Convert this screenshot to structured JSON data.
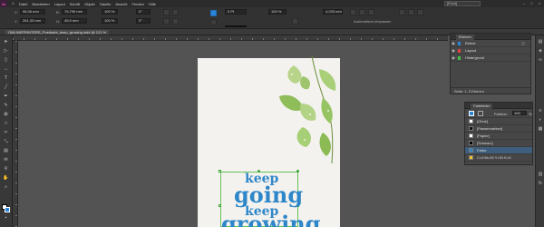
{
  "menubar": {
    "logo": "Id",
    "items": [
      "Datei",
      "Bearbeiten",
      "Layout",
      "Schrift",
      "Objekt",
      "Tabelle",
      "Ansicht",
      "Fenster",
      "Hilfe"
    ],
    "workspace": "[Einst]"
  },
  "control": {
    "x": "98,36 mm",
    "y": "261,33 mm",
    "w": "75,799 mm",
    "h": "45,9 mm",
    "scale_x": "100 %",
    "scale_y": "100 %",
    "angle": "0°",
    "shear": "0°",
    "stroke": "0 Pt",
    "zoom": "100 %",
    "autofit": "Automatisch einpassen",
    "corner": "4,233 mm"
  },
  "document": {
    "tab": "OMLINEPRINTERS_Postkarte_keep_growing.indd @ 121 %"
  },
  "artwork": {
    "line1": "keep",
    "line2": "going",
    "line3": "keep",
    "line4": "growing",
    "text_color": "#2e87c9"
  },
  "layers_panel": {
    "title": "Ebenen",
    "rows": [
      {
        "name": "Ebene",
        "color": "#2a85d8",
        "selected": false
      },
      {
        "name": "Layout",
        "color": "#e04343",
        "selected": false
      },
      {
        "name": "Hintergrund",
        "color": "#43c043",
        "selected": false
      }
    ],
    "footer": "Seite: 1, 3 Ebenen"
  },
  "swatches_panel": {
    "title": "Farbfelder",
    "tint_label": "Farbton:",
    "tint_value": "100",
    "tint_unit": "%",
    "rows": [
      {
        "name": "[Ohne]",
        "color": "#ffffff",
        "selected": false
      },
      {
        "name": "[Passermarken]",
        "color": "#111111",
        "selected": false
      },
      {
        "name": "[Papier]",
        "color": "#ffffff",
        "selected": false
      },
      {
        "name": "[Schwarz]",
        "color": "#000000",
        "selected": false
      },
      {
        "name": "Farbe",
        "color": "#2e87c9",
        "selected": true
      },
      {
        "name": "C=0 M=20 Y=91 K=0",
        "color": "#f4c42a",
        "selected": false
      }
    ]
  }
}
